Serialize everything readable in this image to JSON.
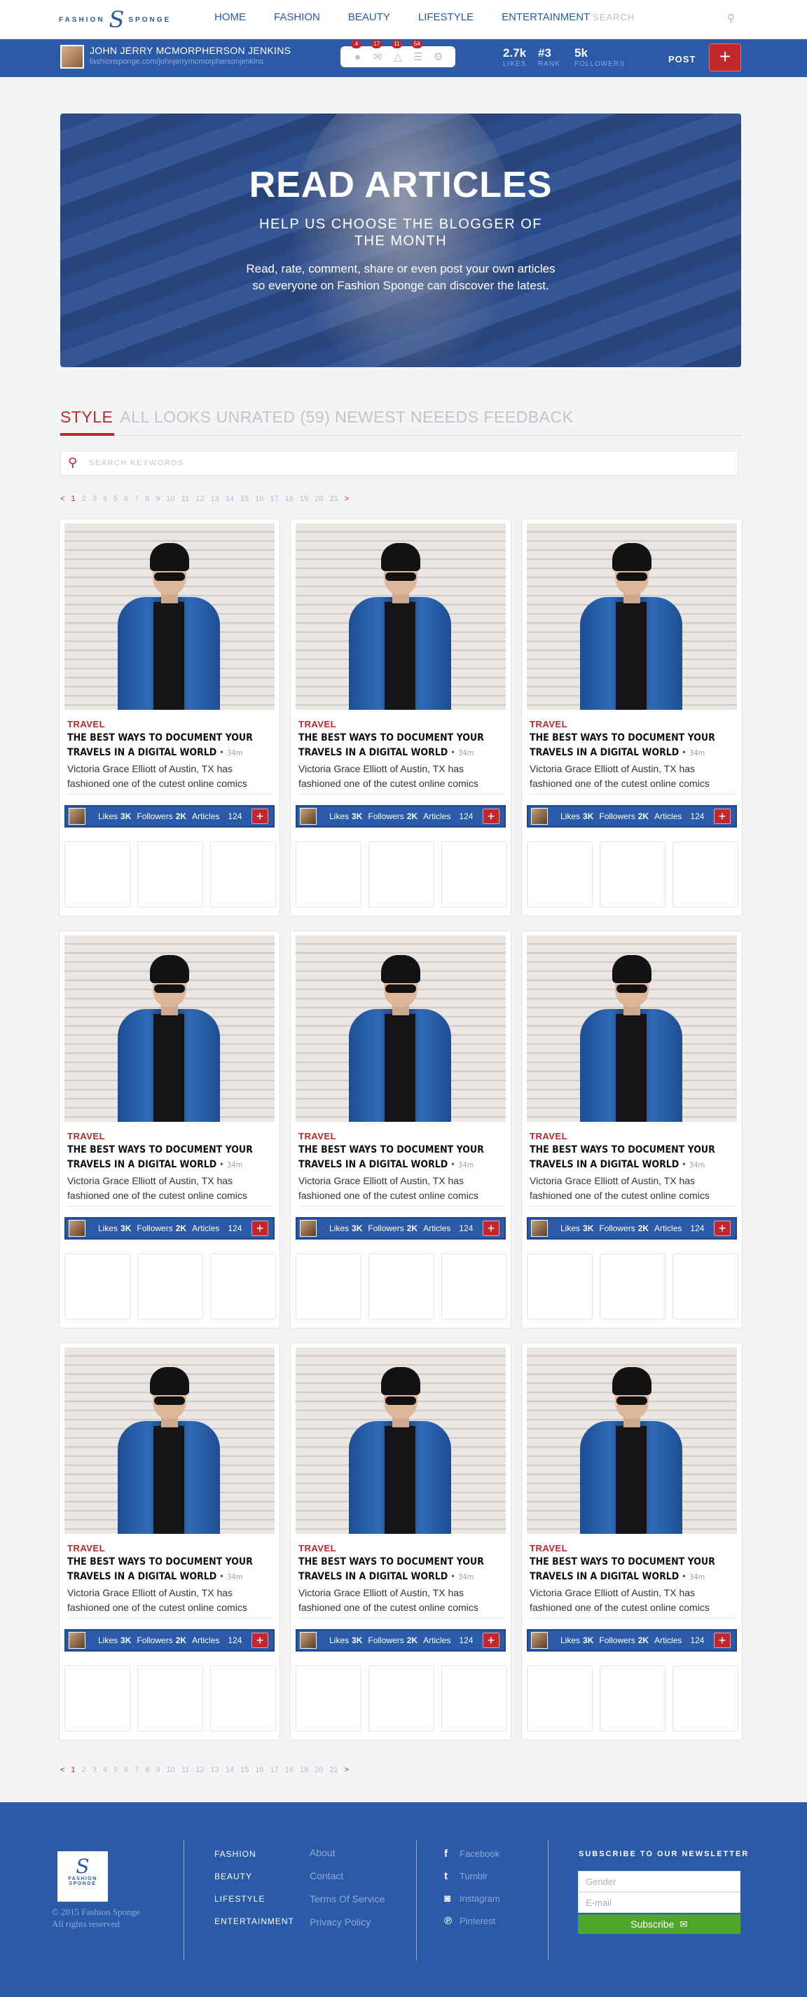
{
  "brand": {
    "left": "FASHION",
    "mark": "S",
    "right": "SPONGE"
  },
  "nav": {
    "items": [
      "HOME",
      "FASHION",
      "BEAUTY",
      "LIFESTYLE",
      "ENTERTAINMENT"
    ],
    "search_placeholder": "SEARCH"
  },
  "profile": {
    "name": "JOHN JERRY MCMORPHERSON JENKINS",
    "url": "fashionsponge.com/johnjerrymcmorphersonjenkins",
    "icons": [
      {
        "icon": "user-icon",
        "badge": "4"
      },
      {
        "icon": "mail-icon",
        "badge": "17"
      },
      {
        "icon": "people-icon",
        "badge": "11"
      },
      {
        "icon": "list-icon",
        "badge": "54"
      },
      {
        "icon": "gear-icon",
        "badge": ""
      }
    ],
    "stats": [
      {
        "value": "2.7k",
        "label": "LIKES"
      },
      {
        "value": "#3",
        "label": "RANK"
      },
      {
        "value": "5k",
        "label": "FOLLOWERS"
      }
    ],
    "post_label": "POST",
    "post_button": "+"
  },
  "hero": {
    "title": "READ ARTICLES",
    "subtitle": "HELP US CHOOSE THE BLOGGER OF THE MONTH",
    "body": "Read, rate, comment, share or even post your own articles so everyone on Fashion Sponge can discover the latest."
  },
  "section": {
    "active": "STYLE",
    "rest": "ALL LOOKS UNRATED (59) NEWEST NEEEDS FEEDBACK"
  },
  "search": {
    "placeholder": "SEARCH KEYWORDS"
  },
  "pagination": {
    "prev": "<",
    "next": ">",
    "current": "1",
    "pages": [
      "1",
      "2",
      "3",
      "4",
      "5",
      "6",
      "7",
      "8",
      "9",
      "10",
      "11",
      "12",
      "13",
      "14",
      "15",
      "16",
      "17",
      "18",
      "19",
      "20",
      "21"
    ]
  },
  "card": {
    "category": "TRAVEL",
    "title": "THE BEST WAYS TO DOCUMENT YOUR TRAVELS IN A DIGITAL WORLD",
    "dot": "•",
    "time": "34m",
    "description": "Victoria Grace Elliott of Austin, TX has fashioned one of the cutest online comics",
    "likes_label": "Likes",
    "likes_value": "3K",
    "followers_label": "Followers",
    "followers_value": "2K",
    "articles_label": "Articles",
    "articles_value": "124",
    "plus": "+"
  },
  "card_count": 9,
  "footer": {
    "logo_top": "FASHION",
    "logo_mark": "S",
    "logo_bottom": "SPONGE",
    "copyright": "© 2015 Fashion Sponge",
    "rights": "All rights reserved",
    "categories": [
      "FASHION",
      "BEAUTY",
      "LIFESTYLE",
      "ENTERTAINMENT"
    ],
    "links": [
      "About",
      "Contact",
      "Terms Of Service",
      "Privacy Policy"
    ],
    "social": [
      {
        "icon": "facebook-icon",
        "glyph": "f",
        "label": "Facebook"
      },
      {
        "icon": "tumblr-icon",
        "glyph": "t",
        "label": "Tumblr"
      },
      {
        "icon": "instagram-icon",
        "glyph": "◙",
        "label": "Instagram"
      },
      {
        "icon": "pinterest-icon",
        "glyph": "℗",
        "label": "Pinterest"
      }
    ],
    "newsletter_title": "SUBSCRIBE TO OUR NEWSLETTER",
    "gender_placeholder": "Gender",
    "email_placeholder": "E-mail",
    "subscribe_label": "Subscribe"
  },
  "colors": {
    "brand_blue": "#2a5aa8",
    "accent_red": "#c0272d",
    "subscribe_green": "#4ea62c"
  }
}
